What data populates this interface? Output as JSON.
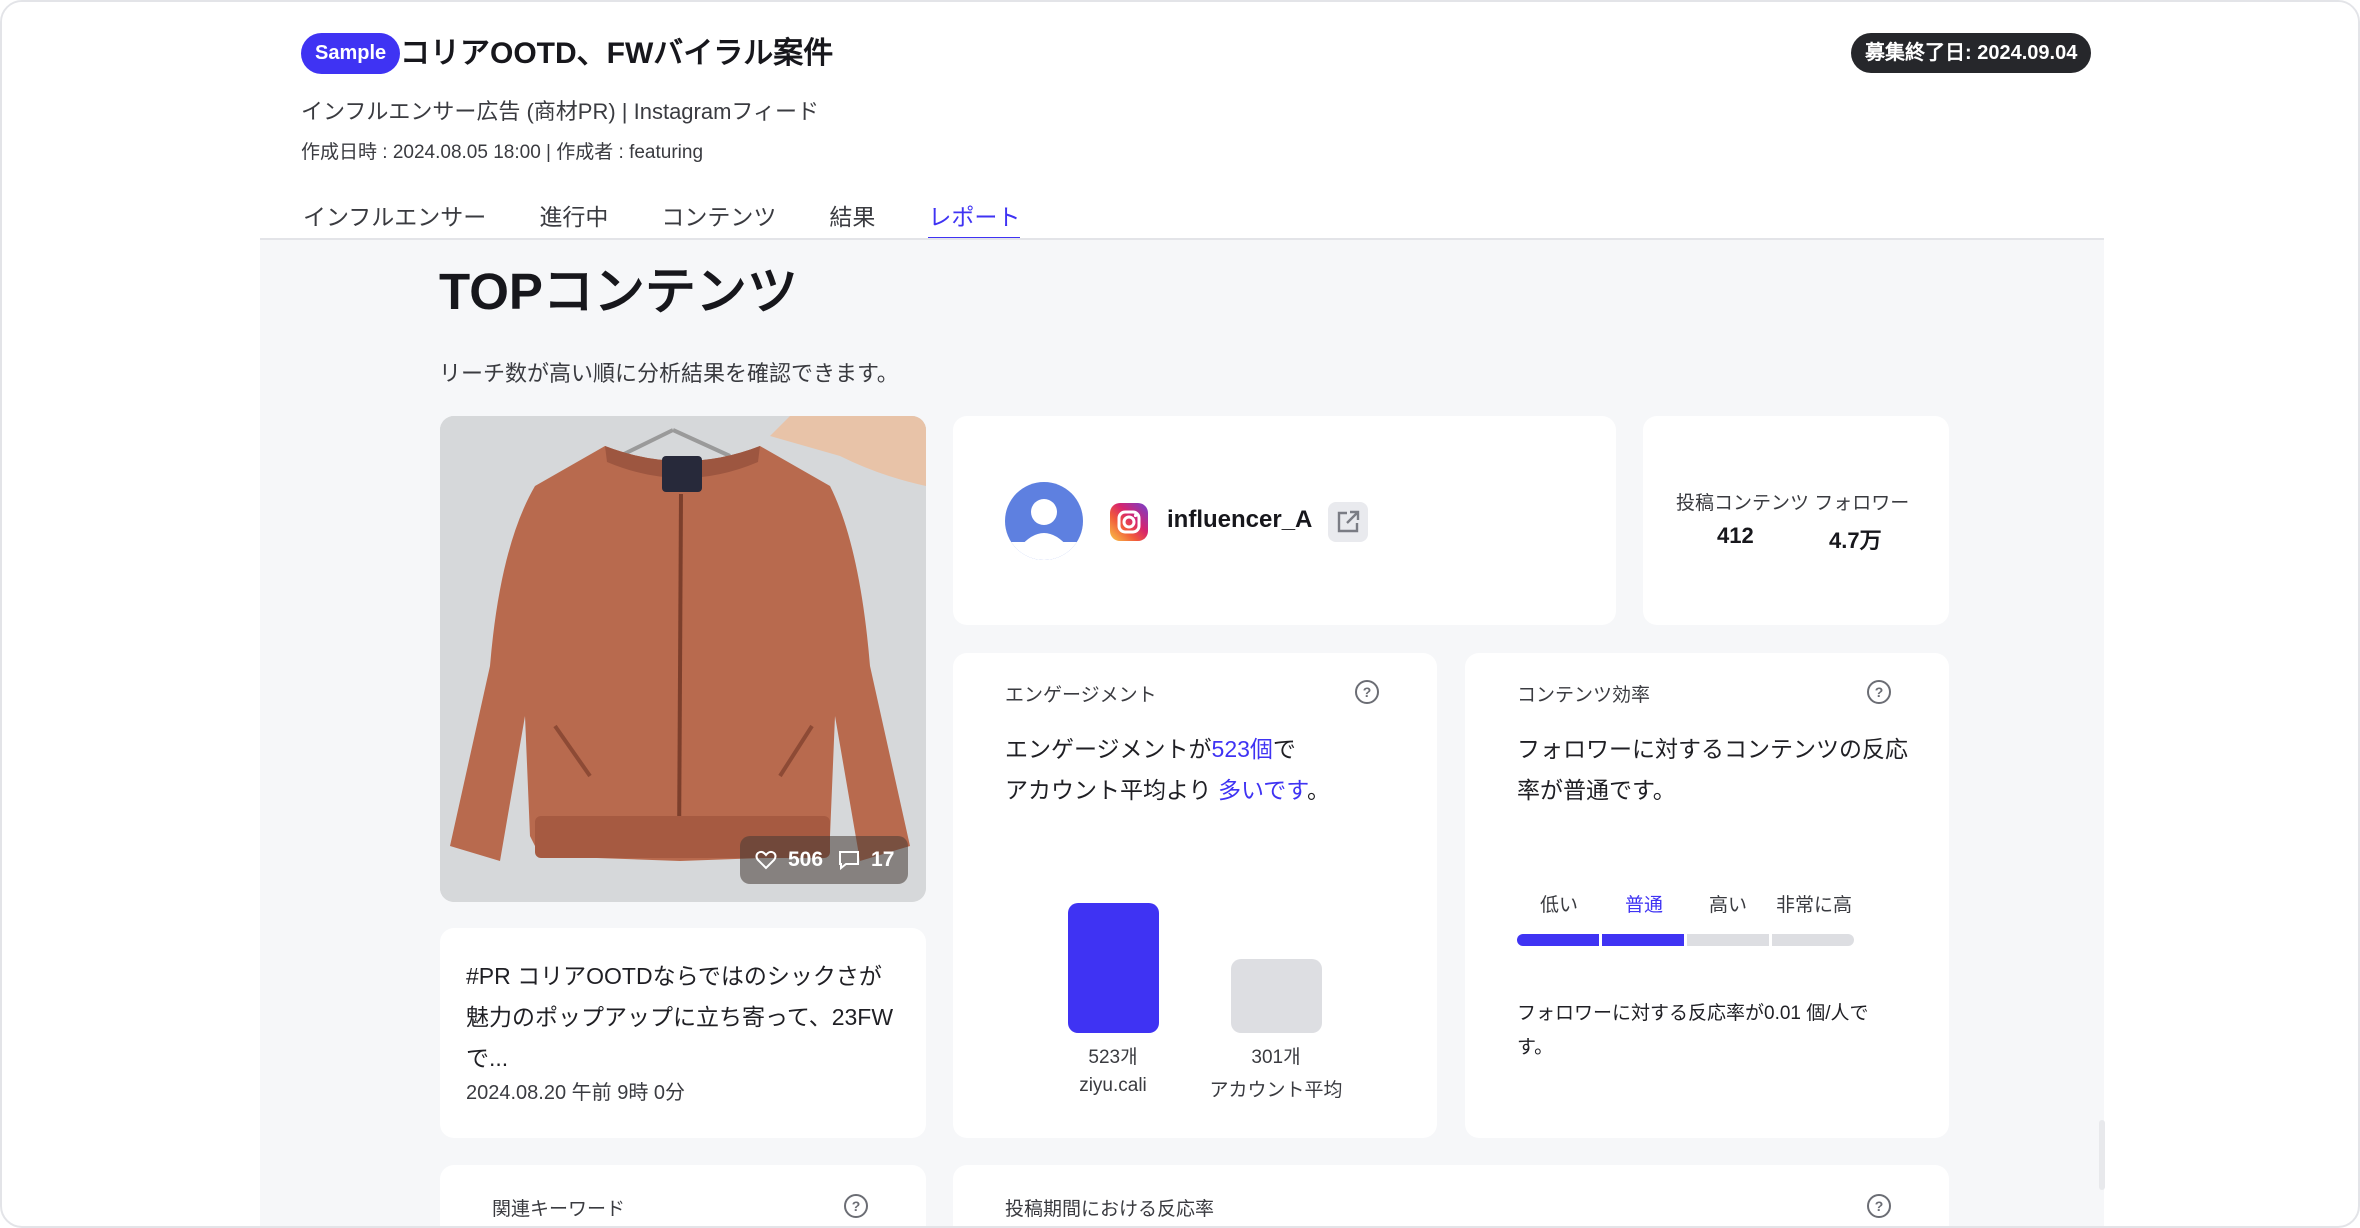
{
  "header": {
    "badge": "Sample",
    "title": "コリアOOTD、FWバイラル案件",
    "deadline": "募集終了日: 2024.09.04",
    "subtitle": "インフルエンサー広告 (商材PR) | Instagramフィード",
    "meta": "作成日時 : 2024.08.05 18:00 | 作成者 : featuring"
  },
  "tabs": [
    {
      "label": "インフルエンサー",
      "active": false
    },
    {
      "label": "進行中",
      "active": false
    },
    {
      "label": "コンテンツ",
      "active": false
    },
    {
      "label": "結果",
      "active": false
    },
    {
      "label": "レポート",
      "active": true
    }
  ],
  "section": {
    "title": "TOPコンテンツ",
    "description": "リーチ数が高い順に分析結果を確認できます。"
  },
  "post": {
    "likes": "506",
    "comments": "17",
    "caption": "#PR コリアOOTDならではのシックさが魅力のポップアップに立ち寄って、23FWで...",
    "date": "2024.08.20 午前 9時 0分"
  },
  "influencer": {
    "handle": "influencer_A",
    "stats_label": "投稿コンテンツ フォロワー",
    "posts": "412",
    "followers": "4.7万"
  },
  "engagement": {
    "heading": "エンゲージメント",
    "line1_prefix": "エンゲージメントが",
    "line1_value": "523個",
    "line1_suffix": "で",
    "line2_prefix": "アカウント平均より ",
    "line2_value": "多いです",
    "line2_suffix": "。",
    "bars": [
      {
        "value": 523,
        "value_label": "523개",
        "name": "ziyu.cali"
      },
      {
        "value": 301,
        "value_label": "301개",
        "name": "アカウント平均"
      }
    ]
  },
  "efficiency": {
    "heading": "コンテンツ効率",
    "summary": "フォロワーに対するコンテンツの反応率が普通です。",
    "scale": [
      "低い",
      "普通",
      "高い",
      "非常に高"
    ],
    "active_index": 1,
    "note": "フォロワーに対する反応率が0.01 個/人です。"
  },
  "bottom": {
    "keywords_heading": "関連キーワード",
    "period_heading": "投稿期間における反応率"
  },
  "colors": {
    "accent": "#3f33f3",
    "bar_inactive": "#dddee2",
    "badge_dark": "#26272b"
  },
  "icons": {
    "like": "heart-icon",
    "comment": "comment-icon",
    "external": "external-link-icon",
    "help": "help-circle-icon",
    "platform": "instagram-icon"
  }
}
